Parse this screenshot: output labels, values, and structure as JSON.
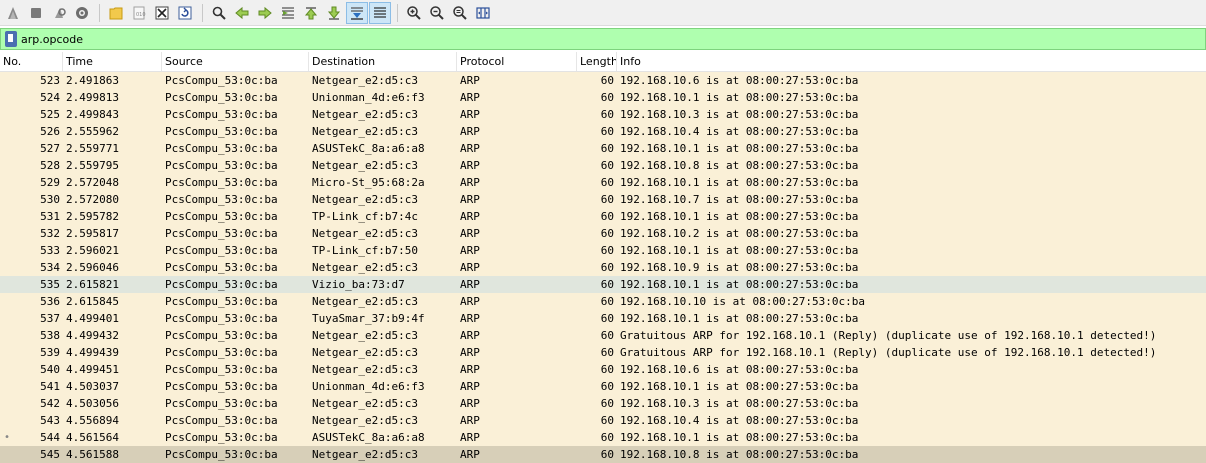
{
  "toolbar": {
    "buttons": [
      {
        "name": "start-capture-icon"
      },
      {
        "name": "stop-capture-icon"
      },
      {
        "name": "restart-capture-icon"
      },
      {
        "name": "capture-options-icon"
      },
      {
        "sep": true
      },
      {
        "name": "open-file-icon"
      },
      {
        "name": "save-file-icon"
      },
      {
        "name": "close-file-icon"
      },
      {
        "name": "reload-file-icon"
      },
      {
        "sep": true
      },
      {
        "name": "find-packet-icon"
      },
      {
        "name": "go-back-icon"
      },
      {
        "name": "go-forward-icon"
      },
      {
        "name": "go-to-packet-icon"
      },
      {
        "name": "go-first-packet-icon"
      },
      {
        "name": "go-last-packet-icon"
      },
      {
        "name": "auto-scroll-icon",
        "active": true
      },
      {
        "name": "colorize-icon",
        "active": true
      },
      {
        "sep": true
      },
      {
        "name": "zoom-in-icon"
      },
      {
        "name": "zoom-out-icon"
      },
      {
        "name": "zoom-normal-icon"
      },
      {
        "name": "resize-columns-icon"
      }
    ]
  },
  "filter": {
    "value": "arp.opcode",
    "color": "#afffaf"
  },
  "columns": [
    "No.",
    "Time",
    "Source",
    "Destination",
    "Protocol",
    "Length",
    "Info"
  ],
  "rows": [
    {
      "no": "523",
      "time": "2.491863",
      "src": "PcsCompu_53:0c:ba",
      "dst": "Netgear_e2:d5:c3",
      "proto": "ARP",
      "len": "60",
      "info": "192.168.10.6 is at 08:00:27:53:0c:ba"
    },
    {
      "no": "524",
      "time": "2.499813",
      "src": "PcsCompu_53:0c:ba",
      "dst": "Unionman_4d:e6:f3",
      "proto": "ARP",
      "len": "60",
      "info": "192.168.10.1 is at 08:00:27:53:0c:ba"
    },
    {
      "no": "525",
      "time": "2.499843",
      "src": "PcsCompu_53:0c:ba",
      "dst": "Netgear_e2:d5:c3",
      "proto": "ARP",
      "len": "60",
      "info": "192.168.10.3 is at 08:00:27:53:0c:ba"
    },
    {
      "no": "526",
      "time": "2.555962",
      "src": "PcsCompu_53:0c:ba",
      "dst": "Netgear_e2:d5:c3",
      "proto": "ARP",
      "len": "60",
      "info": "192.168.10.4 is at 08:00:27:53:0c:ba"
    },
    {
      "no": "527",
      "time": "2.559771",
      "src": "PcsCompu_53:0c:ba",
      "dst": "ASUSTekC_8a:a6:a8",
      "proto": "ARP",
      "len": "60",
      "info": "192.168.10.1 is at 08:00:27:53:0c:ba"
    },
    {
      "no": "528",
      "time": "2.559795",
      "src": "PcsCompu_53:0c:ba",
      "dst": "Netgear_e2:d5:c3",
      "proto": "ARP",
      "len": "60",
      "info": "192.168.10.8 is at 08:00:27:53:0c:ba"
    },
    {
      "no": "529",
      "time": "2.572048",
      "src": "PcsCompu_53:0c:ba",
      "dst": "Micro-St_95:68:2a",
      "proto": "ARP",
      "len": "60",
      "info": "192.168.10.1 is at 08:00:27:53:0c:ba"
    },
    {
      "no": "530",
      "time": "2.572080",
      "src": "PcsCompu_53:0c:ba",
      "dst": "Netgear_e2:d5:c3",
      "proto": "ARP",
      "len": "60",
      "info": "192.168.10.7 is at 08:00:27:53:0c:ba"
    },
    {
      "no": "531",
      "time": "2.595782",
      "src": "PcsCompu_53:0c:ba",
      "dst": "TP-Link_cf:b7:4c",
      "proto": "ARP",
      "len": "60",
      "info": "192.168.10.1 is at 08:00:27:53:0c:ba"
    },
    {
      "no": "532",
      "time": "2.595817",
      "src": "PcsCompu_53:0c:ba",
      "dst": "Netgear_e2:d5:c3",
      "proto": "ARP",
      "len": "60",
      "info": "192.168.10.2 is at 08:00:27:53:0c:ba"
    },
    {
      "no": "533",
      "time": "2.596021",
      "src": "PcsCompu_53:0c:ba",
      "dst": "TP-Link_cf:b7:50",
      "proto": "ARP",
      "len": "60",
      "info": "192.168.10.1 is at 08:00:27:53:0c:ba"
    },
    {
      "no": "534",
      "time": "2.596046",
      "src": "PcsCompu_53:0c:ba",
      "dst": "Netgear_e2:d5:c3",
      "proto": "ARP",
      "len": "60",
      "info": "192.168.10.9 is at 08:00:27:53:0c:ba"
    },
    {
      "no": "535",
      "time": "2.615821",
      "src": "PcsCompu_53:0c:ba",
      "dst": "Vizio_ba:73:d7",
      "proto": "ARP",
      "len": "60",
      "info": "192.168.10.1 is at 08:00:27:53:0c:ba",
      "style": "sel-light"
    },
    {
      "no": "536",
      "time": "2.615845",
      "src": "PcsCompu_53:0c:ba",
      "dst": "Netgear_e2:d5:c3",
      "proto": "ARP",
      "len": "60",
      "info": "192.168.10.10 is at 08:00:27:53:0c:ba"
    },
    {
      "no": "537",
      "time": "4.499401",
      "src": "PcsCompu_53:0c:ba",
      "dst": "TuyaSmar_37:b9:4f",
      "proto": "ARP",
      "len": "60",
      "info": "192.168.10.1 is at 08:00:27:53:0c:ba"
    },
    {
      "no": "538",
      "time": "4.499432",
      "src": "PcsCompu_53:0c:ba",
      "dst": "Netgear_e2:d5:c3",
      "proto": "ARP",
      "len": "60",
      "info": "Gratuitous ARP for 192.168.10.1 (Reply) (duplicate use of 192.168.10.1 detected!)"
    },
    {
      "no": "539",
      "time": "4.499439",
      "src": "PcsCompu_53:0c:ba",
      "dst": "Netgear_e2:d5:c3",
      "proto": "ARP",
      "len": "60",
      "info": "Gratuitous ARP for 192.168.10.1 (Reply) (duplicate use of 192.168.10.1 detected!)"
    },
    {
      "no": "540",
      "time": "4.499451",
      "src": "PcsCompu_53:0c:ba",
      "dst": "Netgear_e2:d5:c3",
      "proto": "ARP",
      "len": "60",
      "info": "192.168.10.6 is at 08:00:27:53:0c:ba"
    },
    {
      "no": "541",
      "time": "4.503037",
      "src": "PcsCompu_53:0c:ba",
      "dst": "Unionman_4d:e6:f3",
      "proto": "ARP",
      "len": "60",
      "info": "192.168.10.1 is at 08:00:27:53:0c:ba"
    },
    {
      "no": "542",
      "time": "4.503056",
      "src": "PcsCompu_53:0c:ba",
      "dst": "Netgear_e2:d5:c3",
      "proto": "ARP",
      "len": "60",
      "info": "192.168.10.3 is at 08:00:27:53:0c:ba"
    },
    {
      "no": "543",
      "time": "4.556894",
      "src": "PcsCompu_53:0c:ba",
      "dst": "Netgear_e2:d5:c3",
      "proto": "ARP",
      "len": "60",
      "info": "192.168.10.4 is at 08:00:27:53:0c:ba"
    },
    {
      "no": "544",
      "time": "4.561564",
      "src": "PcsCompu_53:0c:ba",
      "dst": "ASUSTekC_8a:a6:a8",
      "proto": "ARP",
      "len": "60",
      "info": "192.168.10.1 is at 08:00:27:53:0c:ba",
      "marker": "•"
    },
    {
      "no": "545",
      "time": "4.561588",
      "src": "PcsCompu_53:0c:ba",
      "dst": "Netgear_e2:d5:c3",
      "proto": "ARP",
      "len": "60",
      "info": "192.168.10.8 is at 08:00:27:53:0c:ba",
      "style": "sel-dark"
    }
  ],
  "colors": {
    "row_bg": "#faf0d7",
    "filter_bg": "#afffaf",
    "selected_light": "#e0e6dd",
    "selected_dark": "#d7cfb8"
  }
}
